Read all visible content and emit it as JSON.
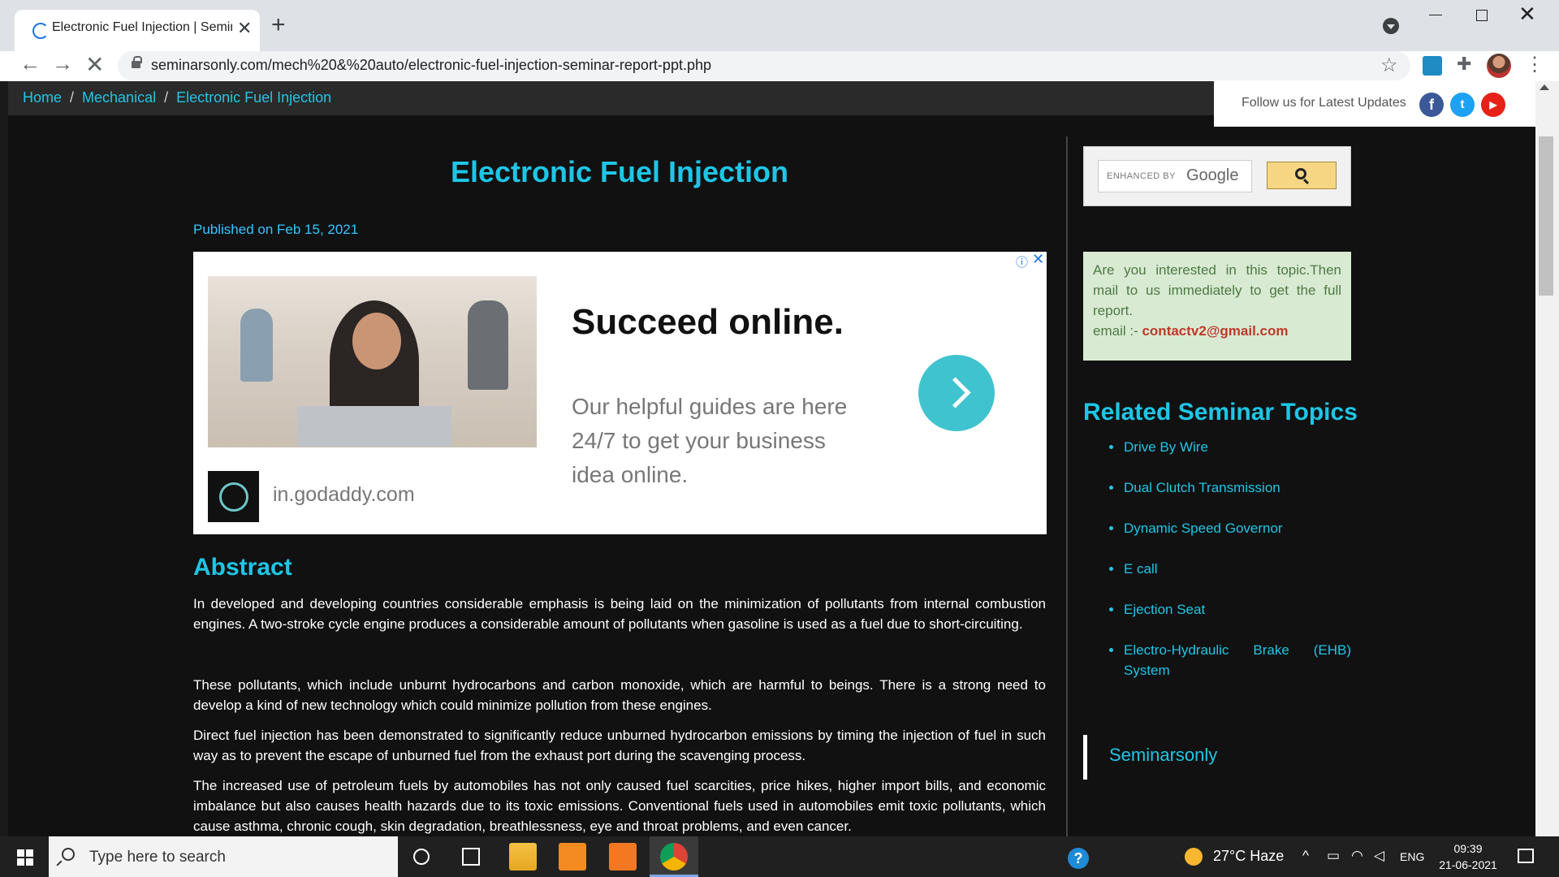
{
  "browser": {
    "tab_title": "Electronic Fuel Injection | Semina",
    "tab_close": "✕",
    "new_tab": "+",
    "url": "seminarsonly.com/mech%20&%20auto/electronic-fuel-injection-seminar-report-ppt.php"
  },
  "breadcrumb": {
    "home": "Home",
    "mechanical": "Mechanical",
    "current": "Electronic Fuel Injection",
    "separator": "/"
  },
  "follow": {
    "text": "Follow us for Latest Updates",
    "facebook": "f",
    "twitter": "t",
    "youtube": "▶"
  },
  "article": {
    "title": "Electronic Fuel Injection",
    "published": "Published on Feb 15, 2021",
    "abstract_heading": "Abstract",
    "paragraphs": [
      "In developed and developing countries considerable emphasis is being laid on the minimization of pollutants from internal combustion engines. A two-stroke cycle engine produces a considerable amount of pollutants when gasoline is used as a fuel due to short-circuiting.",
      "These pollutants, which include unburnt hydrocarbons and carbon monoxide, which are harmful to beings. There is a strong need to develop a kind of new technology which could minimize pollution from these engines.",
      "Direct fuel injection has been demonstrated to significantly reduce unburned hydrocarbon emissions by timing the injection of fuel in such way as to prevent the escape of unburned fuel from the exhaust port during the scavenging process.",
      "The increased use of petroleum fuels by automobiles has not only caused fuel scarcities, price hikes, higher import bills, and economic imbalance but also causes health hazards due to its toxic emissions. Conventional fuels used in automobiles emit toxic pollutants, which cause asthma, chronic cough, skin degradation, breathlessness, eye and throat problems, and even cancer."
    ]
  },
  "ad": {
    "headline": "Succeed online.",
    "body": "Our helpful guides are here 24/7 to get your business idea online.",
    "domain": "in.godaddy.com",
    "info": "ⓘ",
    "close": "✕"
  },
  "sidebar": {
    "search_enhanced": "ENHANCED BY",
    "search_google": "Google",
    "interest_text": "Are you interested in this topic.Then mail to us immediately to get the full report.",
    "email_label": "email :-",
    "email": "contactv2@gmail.com",
    "related_heading": "Related Seminar Topics",
    "related": [
      "Drive By Wire",
      "Dual Clutch Transmission",
      "Dynamic Speed Governor",
      "E call",
      "Ejection Seat",
      "Electro-Hydraulic Brake (EHB) System"
    ],
    "seminarsonly": "Seminarsonly"
  },
  "taskbar": {
    "search_placeholder": "Type here to search",
    "help": "?",
    "weather": "27°C  Haze",
    "tray_up": "^",
    "lang": "ENG",
    "time": "09:39",
    "date": "21-06-2021"
  },
  "colors": {
    "accent": "#1ec6e6",
    "page_bg": "#111111",
    "interest_bg": "#d8ead2",
    "email_color": "#c0392b"
  }
}
